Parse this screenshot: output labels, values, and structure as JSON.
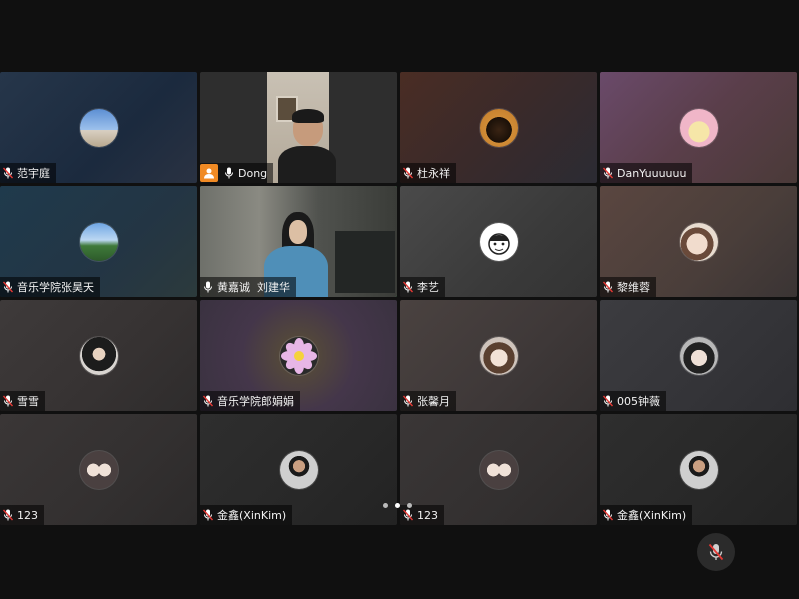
{
  "participants": [
    {
      "name": "范宇庭",
      "avatar": "sky-photo-avatar"
    },
    {
      "name": "Dong",
      "host": true,
      "video": true
    },
    {
      "name": "杜永祥",
      "avatar": "piano-avatar"
    },
    {
      "name": "DanYuuuuuu",
      "avatar": "cartoon-dog-avatar"
    },
    {
      "name": "音乐学院张昊天",
      "avatar": "landscape-avatar"
    },
    {
      "name": "黄嘉诚  刘建华",
      "video": true,
      "active": true
    },
    {
      "name": "李艺",
      "avatar": "cartoon-face-avatar"
    },
    {
      "name": "黎维蓉",
      "avatar": "anime-avatar"
    },
    {
      "name": "雪雪",
      "avatar": "girl-photo-avatar"
    },
    {
      "name": "音乐学院郎娟娟",
      "avatar": "flower-avatar"
    },
    {
      "name": "张馨月",
      "avatar": "anime-girl-avatar"
    },
    {
      "name": "005钟薇",
      "avatar": "anime-boy-avatar"
    },
    {
      "name": "123",
      "avatar": "couple-cartoon-avatar"
    },
    {
      "name": "金鑫(XinKim)",
      "avatar": "man-photo-avatar"
    },
    {
      "name": "123",
      "avatar": "couple-cartoon-avatar"
    },
    {
      "name": "金鑫(XinKim)",
      "avatar": "man-photo-avatar"
    }
  ],
  "pagination": {
    "pages": 3,
    "current": 2
  },
  "controls": {
    "mute_icon": "microphone-muted-icon"
  },
  "colors": {
    "active_border": "#2fbf5a",
    "host_badge": "#f08a24",
    "background": "#101010"
  }
}
